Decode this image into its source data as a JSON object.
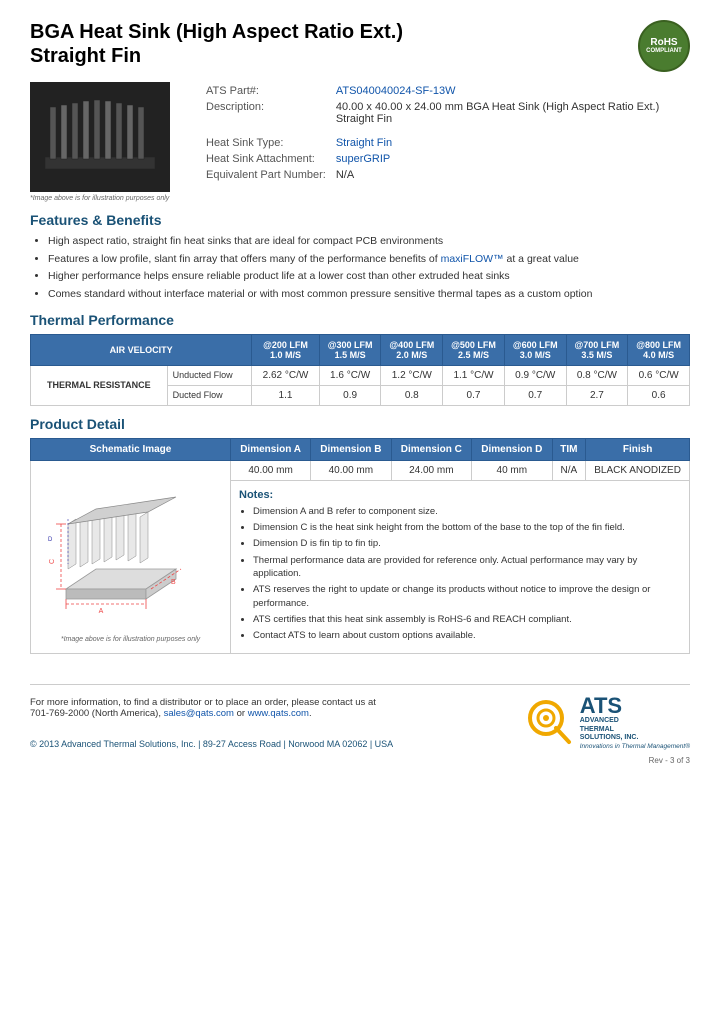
{
  "header": {
    "title_line1": "BGA Heat Sink (High Aspect Ratio Ext.)",
    "title_line2": "Straight Fin",
    "rohs": "RoHS\nCOMPLIANT"
  },
  "product": {
    "part_number_label": "ATS Part#:",
    "part_number_value": "ATS040040024-SF-13W",
    "description_label": "Description:",
    "description_value": "40.00 x 40.00 x 24.00 mm BGA Heat Sink (High Aspect Ratio Ext.) Straight Fin",
    "heat_sink_type_label": "Heat Sink Type:",
    "heat_sink_type_value": "Straight Fin",
    "attachment_label": "Heat Sink Attachment:",
    "attachment_value": "superGRIP",
    "equiv_part_label": "Equivalent Part Number:",
    "equiv_part_value": "N/A",
    "image_caption": "*Image above is for illustration purposes only"
  },
  "features": {
    "section_title": "Features & Benefits",
    "items": [
      "High aspect ratio, straight fin heat sinks that are ideal for compact PCB environments",
      "Features a low profile, slant fin array that offers many of the performance benefits of maxiFLOW™ at a great value",
      "Higher performance helps ensure reliable product life at a lower cost than other extruded heat sinks",
      "Comes standard without interface material or with most common pressure sensitive thermal tapes as a custom option"
    ]
  },
  "thermal": {
    "section_title": "Thermal Performance",
    "col_header_0": "AIR VELOCITY",
    "col_header_1": "@200 LFM\n1.0 M/S",
    "col_header_2": "@300 LFM\n1.5 M/S",
    "col_header_3": "@400 LFM\n2.0 M/S",
    "col_header_4": "@500 LFM\n2.5 M/S",
    "col_header_5": "@600 LFM\n3.0 M/S",
    "col_header_6": "@700 LFM\n3.5 M/S",
    "col_header_7": "@800 LFM\n4.0 M/S",
    "row_label": "THERMAL RESISTANCE",
    "unducted_label": "Unducted Flow",
    "unducted_values": [
      "2.62 °C/W",
      "1.6 °C/W",
      "1.2 °C/W",
      "1.1 °C/W",
      "0.9 °C/W",
      "0.8 °C/W",
      "0.6 °C/W"
    ],
    "ducted_label": "Ducted Flow",
    "ducted_values": [
      "1.1",
      "0.9",
      "0.8",
      "0.7",
      "0.7",
      "2.7",
      "0.6"
    ]
  },
  "product_detail": {
    "section_title": "Product Detail",
    "col_schematic": "Schematic Image",
    "col_dim_a": "Dimension A",
    "col_dim_b": "Dimension B",
    "col_dim_c": "Dimension C",
    "col_dim_d": "Dimension D",
    "col_tim": "TIM",
    "col_finish": "Finish",
    "dim_a_val": "40.00 mm",
    "dim_b_val": "40.00 mm",
    "dim_c_val": "24.00 mm",
    "dim_d_val": "40 mm",
    "tim_val": "N/A",
    "finish_val": "BLACK ANODIZED",
    "image_caption": "*Image above is for illustration purposes only",
    "notes_title": "Notes:",
    "notes": [
      "Dimension A and B refer to component size.",
      "Dimension C is the heat sink height from the bottom of the base to the top of the fin field.",
      "Dimension D is fin tip to fin tip.",
      "Thermal performance data are provided for reference only. Actual performance may vary by application.",
      "ATS reserves the right to update or change its products without notice to improve the design or performance.",
      "ATS certifies that this heat sink assembly is RoHS-6 and REACH compliant.",
      "Contact ATS to learn about custom options available."
    ]
  },
  "footer": {
    "contact_text": "For more information, to find a distributor or to place an order, please contact us at\n701-769-2000 (North America),",
    "email": "sales@qats.com",
    "or_text": "or",
    "website": "www.qats.com",
    "copyright": "© 2013 Advanced Thermal Solutions, Inc. | 89-27 Access Road | Norwood MA  02062 | USA",
    "page_num": "Rev - 3 of 3",
    "ats_brand": "ATS",
    "ats_fullname": "ADVANCED\nTHERMAL\nSOLUTIONS, INC.",
    "ats_tagline": "Innovations in Thermal Management®"
  }
}
